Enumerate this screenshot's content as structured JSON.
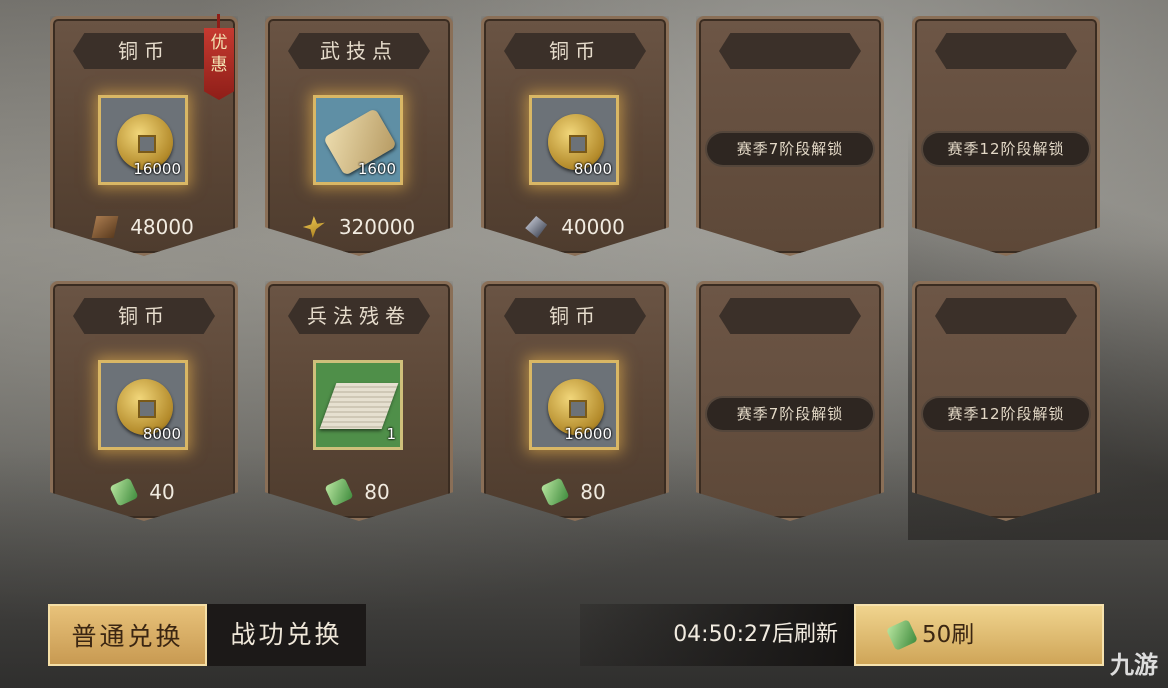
{
  "cards": [
    {
      "title": "铜币",
      "quantity": "16000",
      "price": "48000",
      "price_icon": "wood-icon",
      "item_icon": "copper-coin-icon",
      "badge": "优惠"
    },
    {
      "title": "武技点",
      "quantity": "1600",
      "price": "320000",
      "price_icon": "grain-icon",
      "item_icon": "scroll-icon"
    },
    {
      "title": "铜币",
      "quantity": "8000",
      "price": "40000",
      "price_icon": "iron-icon",
      "item_icon": "copper-coin-icon"
    },
    {
      "locked_text": "赛季7阶段解锁"
    },
    {
      "locked_text": "赛季12阶段解锁"
    },
    {
      "title": "铜币",
      "quantity": "8000",
      "price": "40",
      "price_icon": "money-icon",
      "item_icon": "copper-coin-icon"
    },
    {
      "title": "兵法残卷",
      "quantity": "1",
      "price": "80",
      "price_icon": "money-icon",
      "item_icon": "tactics-fragment-icon"
    },
    {
      "title": "铜币",
      "quantity": "16000",
      "price": "80",
      "price_icon": "money-icon",
      "item_icon": "copper-coin-icon"
    },
    {
      "locked_text": "赛季7阶段解锁"
    },
    {
      "locked_text": "赛季12阶段解锁"
    }
  ],
  "tabs": {
    "normal": "普通兑换",
    "merit": "战功兑换"
  },
  "refresh": {
    "countdown": "04:50:27后刷新",
    "button": "50刷"
  },
  "watermark": "九游"
}
